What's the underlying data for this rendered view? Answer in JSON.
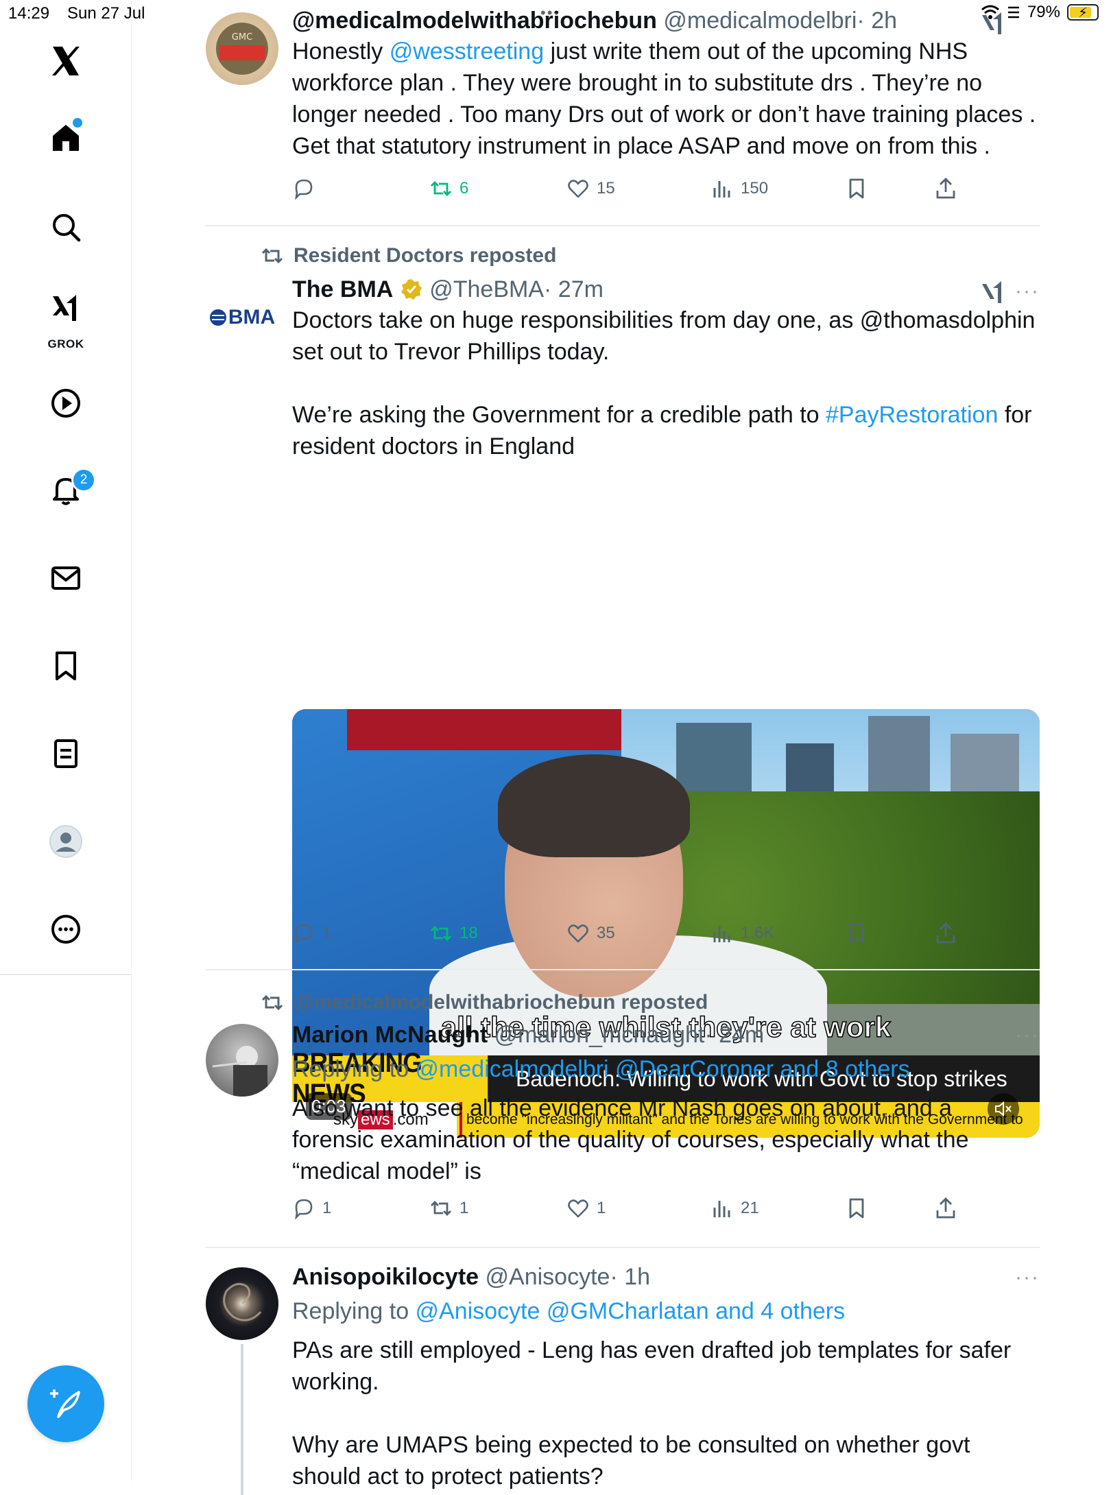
{
  "status_bar": {
    "time": "14:29",
    "date": "Sun 27 Jul",
    "battery": "79%",
    "multitask_dots": "•••"
  },
  "sidebar": {
    "grok_label": "GROK",
    "notification_count": "2",
    "items": [
      "x-logo",
      "home",
      "search",
      "grok",
      "videos",
      "notifications",
      "messages",
      "bookmarks",
      "lists",
      "profile",
      "more"
    ]
  },
  "posts": [
    {
      "name": "@medicalmodelwithabriochebun",
      "handle": "@medicalmodelbri",
      "time": "· 2h",
      "mention": "@wesstreeting",
      "text_after_mention": " just write them out of the upcoming NHS workforce plan . They were brought in to substitute drs . They’re no longer needed . Too many Drs out of work or don’t have training places . Get that statutory instrument in place ASAP and move on from this .",
      "text_before_mention": "Honestly ",
      "stats": {
        "replies": "",
        "reposts": "6",
        "likes": "15",
        "views": "150"
      }
    },
    {
      "social": "Resident Doctors reposted",
      "name": "The BMA",
      "handle": "@TheBMA",
      "time": "· 27m",
      "avatar_text": "BMA",
      "text_part1": "Doctors take on huge responsibilities from day one, as @thomasdolphin set out to Trevor Phillips today.\n\nWe’re asking the Government for a credible path to ",
      "hashtag": "#PayRestoration",
      "text_part2": " for resident doctors in England",
      "video": {
        "caption": "all the time whilst they're at work",
        "breaking_label": "BREAKING NEWS",
        "breaking_headline": "Badenoch: Willing to work with Govt to stop strikes",
        "ticker_logo_prefix": "sky",
        "ticker_logo_red": "ews",
        "ticker_logo_suffix": ".com",
        "ticker_text": "become \"increasingly militant\" and the Tories are willing to work with the Government to",
        "timestamp": "0:03"
      },
      "stats": {
        "replies": "1",
        "reposts": "18",
        "likes": "35",
        "views": "1.6K"
      }
    },
    {
      "social": "@medicalmodelwithabriochebun reposted",
      "name": "Marion McNaught",
      "handle": "@marion_mcnaught",
      "time": "· 24m",
      "replying_prefix": "Replying to ",
      "replying_links": "@medicalmodelbri @DearCoroner and 8 others",
      "text": "Also want to see all the evidence Mr Nash goes on about, and a forensic examination of the quality of courses, especially what the “medical model” is",
      "stats": {
        "replies": "1",
        "reposts": "1",
        "likes": "1",
        "views": "21"
      }
    },
    {
      "name": "Anisopoikilocyte",
      "handle": "@Anisocyte",
      "time": "· 1h",
      "replying_prefix": "Replying to ",
      "replying_links": "@Anisocyte @GMCharlatan and 4 others",
      "text": "PAs are still employed - Leng has even drafted job templates for safer working.\n\nWhy are UMAPS being expected to be consulted on whether govt should act to protect patients?"
    }
  ],
  "more_label": "···"
}
